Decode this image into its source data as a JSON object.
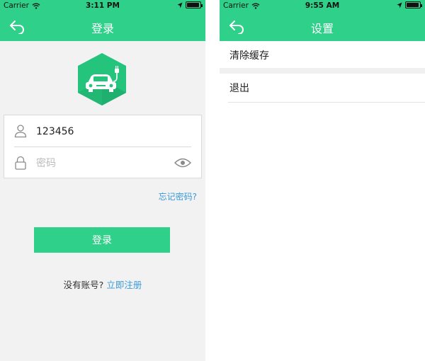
{
  "colors": {
    "brand": "#2fd08a",
    "link": "#3a9ad9",
    "page_bg": "#f2f2f2",
    "divider": "#d9d9d9"
  },
  "login_screen": {
    "status": {
      "carrier": "Carrier",
      "time": "3:11 PM",
      "battery_level": 0.95
    },
    "nav": {
      "title": "登录",
      "back_icon": "back-arrow-icon"
    },
    "logo_icon": "ev-car-charging-hexagon-logo",
    "username": {
      "value": "123456",
      "icon": "user-icon"
    },
    "password": {
      "placeholder": "密码",
      "icon": "lock-icon",
      "toggle_icon": "eye-icon"
    },
    "forgot_link": "忘记密码?",
    "login_button": "登录",
    "register_prompt": "没有账号?",
    "register_link": "立即注册"
  },
  "settings_screen": {
    "status": {
      "carrier": "Carrier",
      "time": "9:55 AM",
      "battery_level": 0.95
    },
    "nav": {
      "title": "设置",
      "back_icon": "back-arrow-icon"
    },
    "items": [
      {
        "label": "清除缓存"
      },
      {
        "label": "退出"
      }
    ]
  }
}
